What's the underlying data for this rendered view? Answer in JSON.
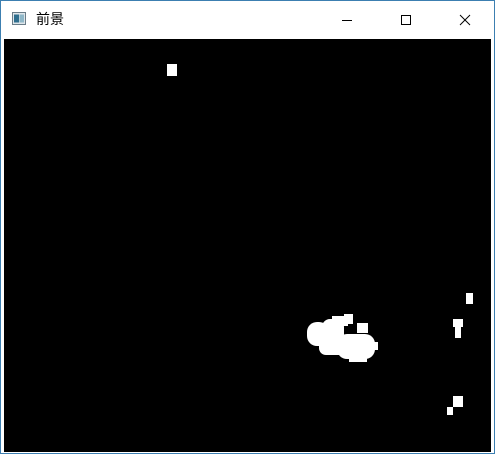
{
  "window": {
    "title": "前景",
    "icon": "app-window-icon",
    "controls": {
      "minimize_icon": "minimize-icon",
      "maximize_icon": "maximize-icon",
      "close_icon": "close-icon"
    }
  },
  "content": {
    "background_color": "#000000",
    "foreground_color": "#ffffff"
  }
}
